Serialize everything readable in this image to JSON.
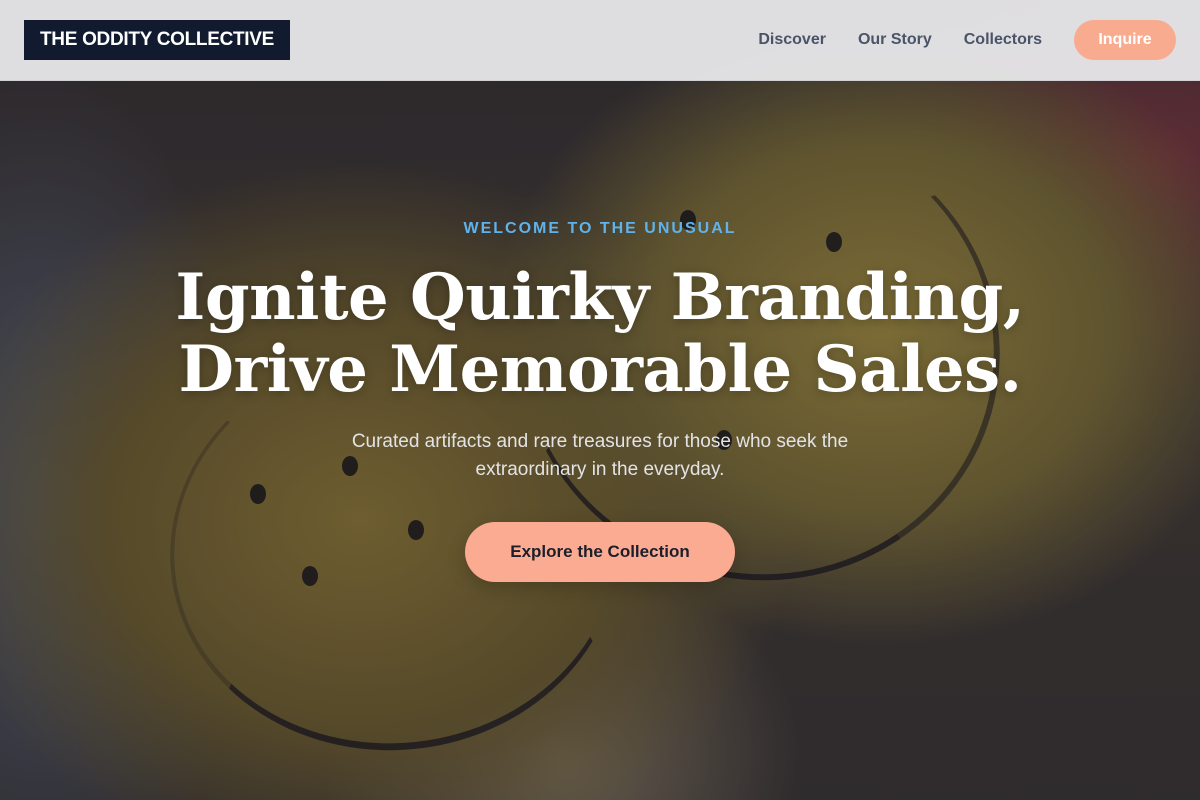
{
  "header": {
    "logo_text": "THE ODDITY COLLECTIVE",
    "nav": [
      {
        "label": "Discover"
      },
      {
        "label": "Our Story"
      },
      {
        "label": "Collectors"
      }
    ],
    "inquire_label": "Inquire"
  },
  "hero": {
    "eyebrow": "WELCOME TO THE UNUSUAL",
    "headline_line1": "Ignite Quirky Branding,",
    "headline_line2": "Drive Memorable Sales.",
    "subtext": "Curated artifacts and rare treasures for those who seek the extraordinary in the everyday.",
    "cta_label": "Explore the Collection"
  },
  "colors": {
    "logo_bg": "#111a2e",
    "accent_peach": "#f9ab90",
    "eyebrow_blue": "#5fb2ea",
    "nav_text": "#4a5468"
  }
}
